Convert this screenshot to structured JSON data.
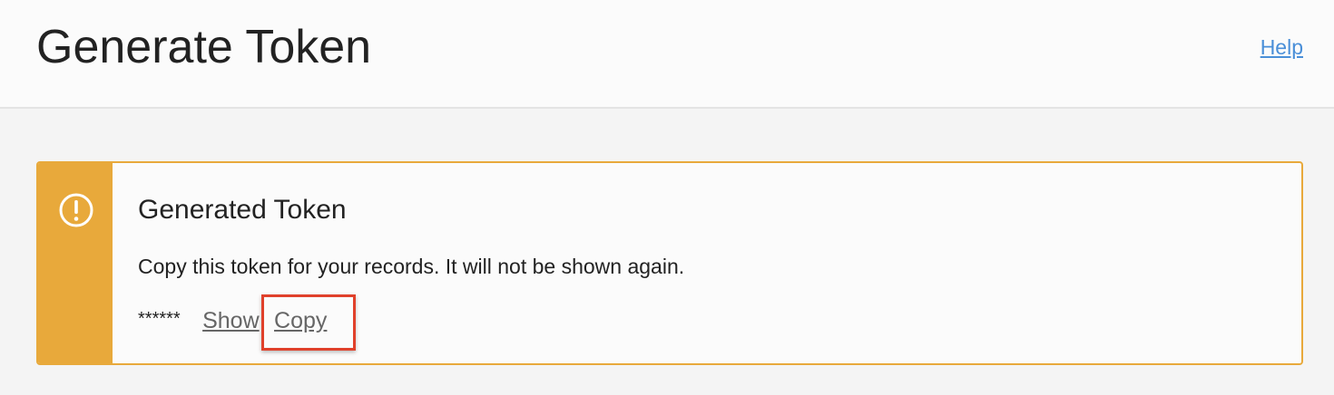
{
  "header": {
    "title": "Generate Token",
    "help_label": "Help"
  },
  "alert": {
    "icon": "exclamation-circle-icon",
    "accent_color": "#e8a93b",
    "title": "Generated Token",
    "message": "Copy this token for your records. It will not be shown again.",
    "token_masked": "******",
    "show_label": "Show",
    "copy_label": "Copy"
  },
  "highlight": {
    "target": "copy-link",
    "color": "#e0412b"
  },
  "colors": {
    "link": "#4a8fd8",
    "secondary_link": "#666666",
    "background": "#f4f4f4"
  }
}
